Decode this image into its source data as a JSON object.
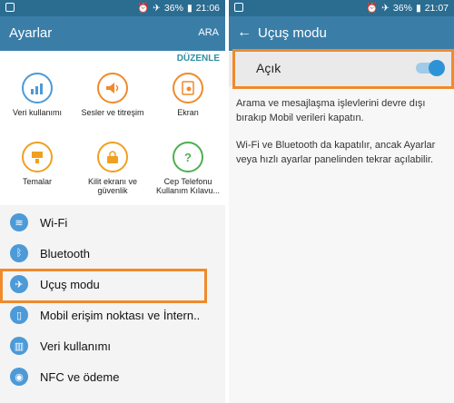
{
  "left": {
    "status": {
      "battery": "36%",
      "time": "21:06"
    },
    "appbar": {
      "title": "Ayarlar",
      "action": "ARA"
    },
    "edit_label": "DÜZENLE",
    "tiles": [
      {
        "label": "Veri kullanımı",
        "icon": "data-usage-icon",
        "color": "#4c9ad8"
      },
      {
        "label": "Sesler ve titreşim",
        "icon": "sound-icon",
        "color": "#f08a2b"
      },
      {
        "label": "Ekran",
        "icon": "display-icon",
        "color": "#f08a2b"
      },
      {
        "label": "Temalar",
        "icon": "themes-icon",
        "color": "#f0a020"
      },
      {
        "label": "Kilit ekranı ve güvenlik",
        "icon": "lock-icon",
        "color": "#f0a020"
      },
      {
        "label": "Cep Telefonu Kullanım Kılavu...",
        "icon": "help-icon",
        "color": "#4caf50"
      }
    ],
    "list": [
      {
        "label": "Wi-Fi",
        "icon": "wifi-icon"
      },
      {
        "label": "Bluetooth",
        "icon": "bluetooth-icon"
      },
      {
        "label": "Uçuş modu",
        "icon": "airplane-icon"
      },
      {
        "label": "Mobil erişim noktası ve İntern..",
        "icon": "hotspot-icon"
      },
      {
        "label": "Veri kullanımı",
        "icon": "data-usage-icon"
      },
      {
        "label": "NFC ve ödeme",
        "icon": "nfc-icon"
      }
    ]
  },
  "right": {
    "status": {
      "battery": "36%",
      "time": "21:07"
    },
    "appbar": {
      "title": "Uçuş modu"
    },
    "toggle": {
      "label": "Açık",
      "on": true
    },
    "desc1": "Arama ve mesajlaşma işlevlerini devre dışı bırakıp Mobil verileri kapatın.",
    "desc2": "Wi-Fi ve Bluetooth da kapatılır, ancak Ayarlar veya hızlı ayarlar panelinden tekrar açılabilir."
  },
  "colors": {
    "statusbar": "#2b6c91",
    "appbar": "#3a7ea8",
    "accent": "#2e93d6",
    "highlight": "#f08a2b"
  }
}
